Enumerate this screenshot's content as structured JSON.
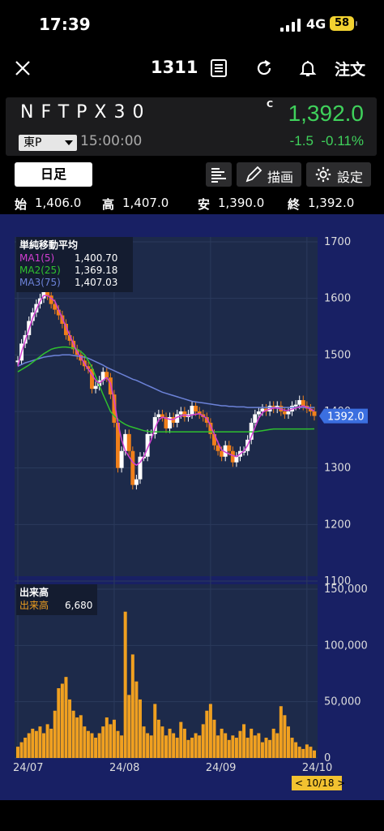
{
  "status": {
    "time": "17:39",
    "network": "4G",
    "battery": "58"
  },
  "nav": {
    "code": "1311",
    "order_label": "注文",
    "close_icon": "close-icon",
    "memo_icon": "document-icon",
    "refresh_icon": "refresh-icon",
    "alert_icon": "bell-icon"
  },
  "quote": {
    "name": "NFTPX30",
    "flag": "C",
    "price": "1,392.0",
    "market": "東P",
    "time": "15:00:00",
    "change": "-1.5",
    "change_pct": "-0.11%",
    "up_color": "#3fd15b"
  },
  "toolbar": {
    "period": "日足",
    "draw_label": "描画",
    "settings_label": "設定"
  },
  "ohlc": {
    "open_label": "始",
    "open": "1,406.0",
    "high_label": "高",
    "high": "1,407.0",
    "low_label": "安",
    "low": "1,390.0",
    "close_label": "終",
    "close": "1,392.0"
  },
  "indicator": {
    "title": "単純移動平均",
    "ma1_label": "MA1(5)",
    "ma1_value": "1,400.70",
    "ma2_label": "MA2(25)",
    "ma2_value": "1,369.18",
    "ma3_label": "MA3(75)",
    "ma3_value": "1,407.03",
    "ma1_color": "#d23fd2",
    "ma2_color": "#2fc02f",
    "ma3_color": "#6c82d8"
  },
  "volume": {
    "title": "出来高",
    "label": "出来高",
    "value": "6,680",
    "color": "#f0a020"
  },
  "price_tag": "1392.0",
  "date_tag": "< 10/18 >",
  "chart_data": {
    "type": "candlestick",
    "x_ticks": [
      "24/07",
      "24/08",
      "24/09",
      "24/10"
    ],
    "y_ticks": [
      "1700",
      "1600",
      "1500",
      "1400",
      "1300",
      "1200",
      "1100"
    ],
    "ylim": [
      1100,
      1700
    ],
    "volume_ticks": [
      "150,000",
      "100,000",
      "50,000",
      "0"
    ],
    "volume_ylim": [
      0,
      150000
    ],
    "closes": [
      1490,
      1520,
      1535,
      1560,
      1575,
      1590,
      1600,
      1620,
      1605,
      1590,
      1580,
      1570,
      1555,
      1535,
      1525,
      1510,
      1500,
      1490,
      1480,
      1475,
      1440,
      1445,
      1455,
      1470,
      1460,
      1430,
      1380,
      1300,
      1330,
      1360,
      1330,
      1270,
      1280,
      1320,
      1320,
      1360,
      1360,
      1390,
      1395,
      1390,
      1370,
      1390,
      1380,
      1395,
      1400,
      1390,
      1395,
      1410,
      1400,
      1395,
      1390,
      1380,
      1360,
      1340,
      1330,
      1320,
      1340,
      1330,
      1310,
      1320,
      1330,
      1330,
      1350,
      1380,
      1395,
      1400,
      1405,
      1400,
      1410,
      1405,
      1410,
      1400,
      1395,
      1400,
      1410,
      1412,
      1420,
      1410,
      1405,
      1400,
      1392
    ],
    "ma1": [
      1480,
      1505,
      1525,
      1545,
      1565,
      1580,
      1595,
      1605,
      1605,
      1600,
      1595,
      1580,
      1565,
      1550,
      1535,
      1520,
      1505,
      1495,
      1485,
      1475,
      1465,
      1455,
      1450,
      1455,
      1460,
      1450,
      1420,
      1380,
      1350,
      1330,
      1320,
      1310,
      1305,
      1310,
      1320,
      1335,
      1350,
      1370,
      1385,
      1390,
      1388,
      1386,
      1386,
      1390,
      1392,
      1394,
      1392,
      1394,
      1395,
      1396,
      1392,
      1388,
      1375,
      1360,
      1345,
      1332,
      1328,
      1325,
      1322,
      1320,
      1325,
      1330,
      1340,
      1355,
      1372,
      1388,
      1398,
      1402,
      1404,
      1406,
      1406,
      1404,
      1402,
      1402,
      1404,
      1406,
      1408,
      1410,
      1407,
      1404,
      1400.7
    ],
    "ma2": [
      1470,
      1474,
      1478,
      1482,
      1487,
      1492,
      1497,
      1502,
      1506,
      1510,
      1512,
      1513,
      1514,
      1514,
      1513,
      1512,
      1510,
      1506,
      1500,
      1490,
      1478,
      1462,
      1446,
      1430,
      1415,
      1400,
      1392,
      1386,
      1381,
      1377,
      1374,
      1372,
      1370,
      1368,
      1366,
      1365,
      1364,
      1364,
      1364,
      1364,
      1364,
      1364,
      1364,
      1364,
      1364,
      1364,
      1364,
      1364,
      1364,
      1364,
      1364,
      1364,
      1364,
      1364,
      1364,
      1364,
      1364,
      1364,
      1364,
      1364,
      1364,
      1364,
      1364,
      1364,
      1364,
      1365,
      1366,
      1367,
      1368,
      1369,
      1369,
      1369,
      1369,
      1369,
      1369,
      1369,
      1369,
      1369,
      1369,
      1369,
      1369.18
    ],
    "ma3": [
      1480,
      1483,
      1486,
      1488,
      1490,
      1492,
      1494,
      1496,
      1497,
      1498,
      1499,
      1499,
      1500,
      1500,
      1500,
      1499,
      1498,
      1497,
      1496,
      1494,
      1491,
      1488,
      1485,
      1482,
      1478,
      1475,
      1472,
      1469,
      1466,
      1463,
      1460,
      1457,
      1455,
      1452,
      1449,
      1446,
      1443,
      1440,
      1437,
      1434,
      1432,
      1430,
      1428,
      1426,
      1424,
      1422,
      1420,
      1418,
      1417,
      1416,
      1415,
      1414,
      1413,
      1412,
      1411,
      1410,
      1410,
      1409,
      1409,
      1408,
      1408,
      1408,
      1407,
      1407,
      1407,
      1407,
      1407,
      1407,
      1407,
      1407,
      1407,
      1407,
      1407,
      1407,
      1407,
      1407,
      1407,
      1407,
      1407,
      1407,
      1407.03
    ],
    "volumes": [
      10,
      14,
      18,
      22,
      26,
      24,
      28,
      22,
      30,
      26,
      42,
      62,
      66,
      72,
      52,
      42,
      36,
      38,
      28,
      24,
      22,
      18,
      22,
      28,
      36,
      30,
      34,
      24,
      20,
      130,
      56,
      92,
      68,
      52,
      28,
      22,
      20,
      48,
      34,
      28,
      20,
      26,
      22,
      18,
      32,
      26,
      16,
      18,
      22,
      20,
      30,
      42,
      48,
      34,
      20,
      26,
      22,
      16,
      20,
      18,
      24,
      30,
      18,
      26,
      20,
      22,
      14,
      18,
      16,
      26,
      22,
      46,
      38,
      28,
      18,
      14,
      10,
      8,
      12,
      10,
      6.68
    ]
  }
}
